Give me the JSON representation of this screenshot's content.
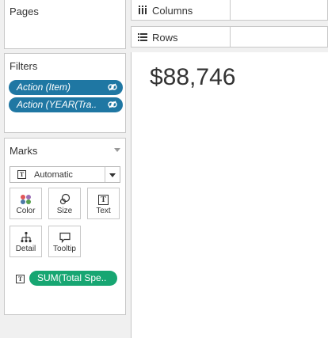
{
  "pages": {
    "title": "Pages"
  },
  "filters": {
    "title": "Filters",
    "items": [
      {
        "label": "Action (Item)"
      },
      {
        "label": "Action (YEAR(Tra.."
      }
    ]
  },
  "marks": {
    "title": "Marks",
    "type_label": "Automatic",
    "buttons": [
      {
        "label": "Color",
        "icon": "color-icon"
      },
      {
        "label": "Size",
        "icon": "size-icon"
      },
      {
        "label": "Text",
        "icon": "text-icon"
      },
      {
        "label": "Detail",
        "icon": "detail-icon"
      },
      {
        "label": "Tooltip",
        "icon": "tooltip-icon"
      }
    ],
    "field_pill": "SUM(Total Spe.."
  },
  "shelves": {
    "columns": "Columns",
    "rows": "Rows"
  },
  "view": {
    "value": "$88,746"
  },
  "colors": {
    "filter_pill": "#1f77a3",
    "measure_pill": "#17a672"
  }
}
